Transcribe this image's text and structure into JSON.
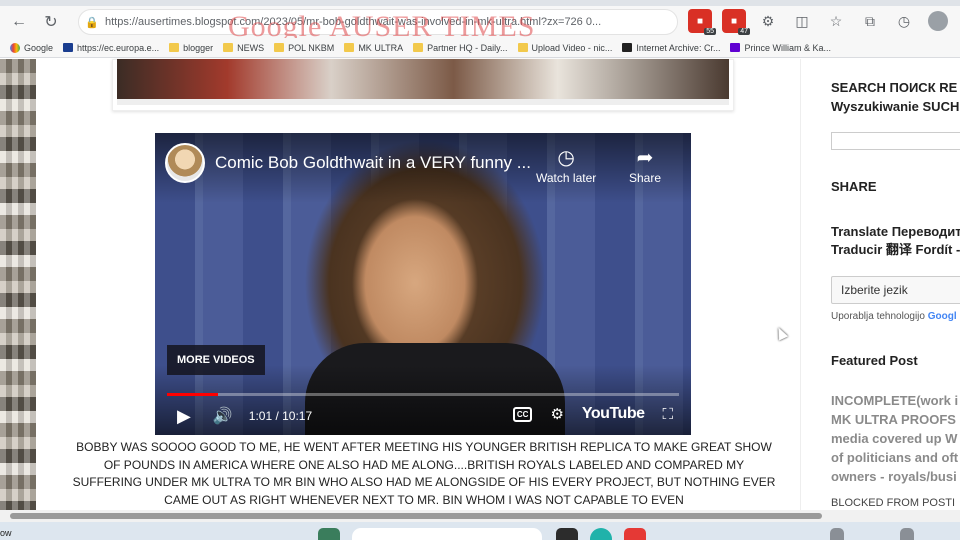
{
  "browser": {
    "url": "https://ausertimes.blogspot.com/2023/05/mr-bob-goldthwait-was-involved-in-mk-ultra.html?zx=726 0...",
    "overlay_title": "Google AUSER TIMES",
    "extensions": [
      {
        "name": "extension-icon-1",
        "badge": "55"
      },
      {
        "name": "extension-icon-2",
        "badge": "47"
      },
      {
        "name": "extensions-puzzle-icon",
        "badge": ""
      },
      {
        "name": "split-screen-icon",
        "badge": ""
      },
      {
        "name": "favorites-icon",
        "badge": ""
      },
      {
        "name": "collections-icon",
        "badge": ""
      },
      {
        "name": "history-icon",
        "badge": ""
      }
    ],
    "bookmarks": [
      {
        "label": "Google",
        "icon": "g"
      },
      {
        "label": "https://ec.europa.e...",
        "icon": "eu"
      },
      {
        "label": "blogger",
        "icon": "folder"
      },
      {
        "label": "NEWS",
        "icon": "folder"
      },
      {
        "label": "POL NKBM",
        "icon": "folder"
      },
      {
        "label": "MK ULTRA",
        "icon": "folder"
      },
      {
        "label": "Partner HQ - Daily...",
        "icon": "folder"
      },
      {
        "label": "Upload Video - nic...",
        "icon": "folder"
      },
      {
        "label": "Internet Archive: Cr...",
        "icon": "ia"
      },
      {
        "label": "Prince William & Ka...",
        "icon": "yh"
      }
    ]
  },
  "video": {
    "title": "Comic Bob Goldthwait in a VERY funny ...",
    "watch_later": "Watch later",
    "share": "Share",
    "more_videos": "MORE VIDEOS",
    "time": "1:01 / 10:17",
    "progress": 0.099,
    "logo": "YouTube"
  },
  "post": {
    "text": "BOBBY WAS SOOOO GOOD TO ME, HE WENT AFTER MEETING HIS YOUNGER BRITISH REPLICA TO MAKE GREAT SHOW OF POUNDS IN AMERICA WHERE ONE ALSO HAD ME ALONG....BRITISH ROYALS LABELED AND COMPARED MY SUFFERING UNDER MK ULTRA TO MR BIN WHO ALSO HAD ME ALONGSIDE OF HIS EVERY PROJECT, BUT NOTHING EVER CAME OUT AS RIGHT WHENEVER NEXT TO MR. BIN WHOM I WAS NOT CAPABLE TO EVEN"
  },
  "sidebar": {
    "search_title_1": "SEARCH ПОИСК RE",
    "search_title_2": "Wyszukiwanie SUCH",
    "share_title": "SHARE",
    "translate_title_1": "Translate Переводит",
    "translate_title_2": "Traducir 翻译 Fordít -",
    "select_language": "Izberite jezik",
    "powered_by": "Uporablja tehnologijo",
    "google": "Googl",
    "featured_title": "Featured Post",
    "featured_lines": [
      "INCOMPLETE(work i",
      "MK ULTRA PROOFS",
      "media covered up W",
      "of politicians and oft",
      "owners - royals/busi"
    ],
    "blocked": "BLOCKED FROM POSTI"
  },
  "taskbar": {
    "left_text": "ow"
  }
}
